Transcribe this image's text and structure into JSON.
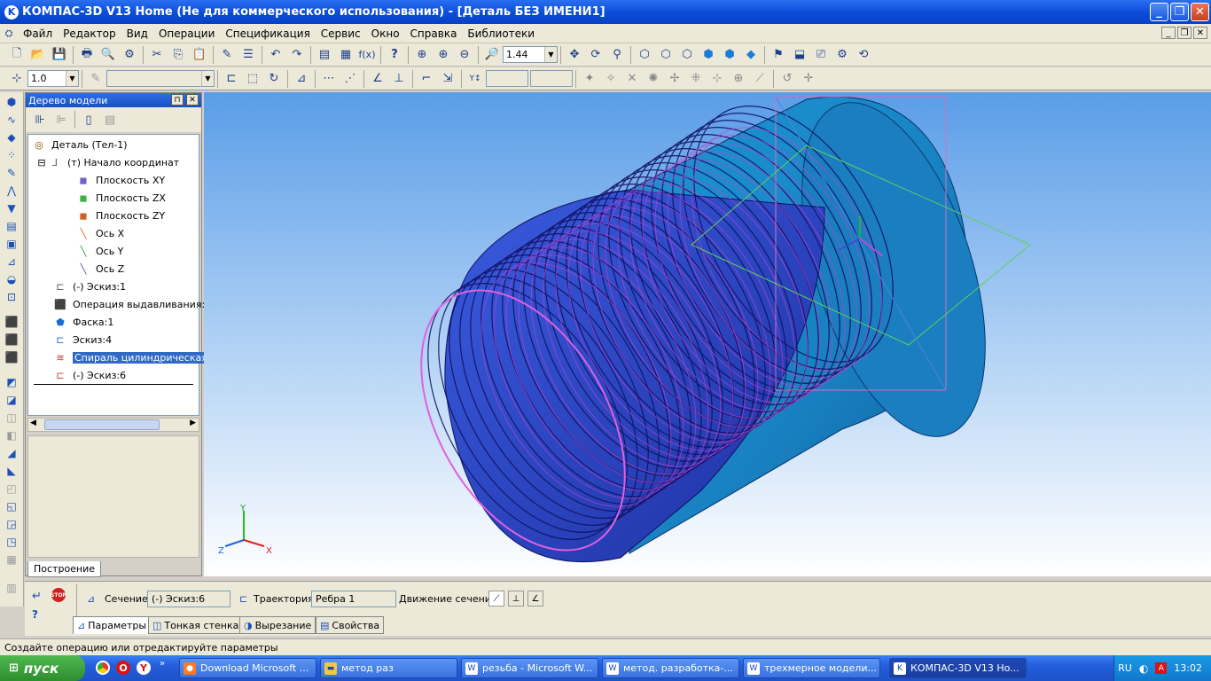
{
  "window": {
    "title": "КОМПАС-3D V13 Home (Не для коммерческого использования) - [Деталь БЕЗ ИМЕНИ1]",
    "app_icon": "kompas-logo-icon"
  },
  "menu": {
    "items": [
      "Файл",
      "Редактор",
      "Вид",
      "Операции",
      "Спецификация",
      "Сервис",
      "Окно",
      "Справка",
      "Библиотеки"
    ]
  },
  "toolbar": {
    "zoom_value": "1.44",
    "step_value": "1.0"
  },
  "tree": {
    "title": "Дерево модели",
    "nodes": [
      {
        "label": "Деталь (Тел-1)"
      },
      {
        "label": "(т) Начало координат"
      },
      {
        "label": "Плоскость XY"
      },
      {
        "label": "Плоскость ZX"
      },
      {
        "label": "Плоскость ZY"
      },
      {
        "label": "Ось X"
      },
      {
        "label": "Ось Y"
      },
      {
        "label": "Ось Z"
      },
      {
        "label": "(-) Эскиз:1"
      },
      {
        "label": "Операция выдавливания:"
      },
      {
        "label": "Фаска:1"
      },
      {
        "label": "Эскиз:4"
      },
      {
        "label": "Спираль цилиндрическая:"
      },
      {
        "label": "(-) Эскиз:6"
      }
    ],
    "bottom_tab": "Построение"
  },
  "viewport": {
    "axis_x": "X",
    "axis_y": "Y",
    "axis_z": "Z",
    "colors": {
      "body": "#1e88c8",
      "helix": "#c040d0",
      "wire": "#101060"
    }
  },
  "properties": {
    "section_label": "Сечение",
    "section_value": "(-) Эскиз:6",
    "trajectory_label": "Траектория",
    "trajectory_value": "Ребра 1",
    "motion_label": "Движение сечения",
    "tabs": [
      "Параметры",
      "Тонкая стенка",
      "Вырезание",
      "Свойства"
    ]
  },
  "status": {
    "text": "Создайте операцию или отредактируйте параметры"
  },
  "taskbar": {
    "start_label": "пуск",
    "tasks": [
      "Download Microsoft ...",
      "метод раз",
      "резьба - Microsoft W...",
      "метод. разработка-...",
      "трехмерное модели...",
      "КОМПАС-3D V13 Ho..."
    ],
    "lang": "RU",
    "clock": "13:02"
  }
}
